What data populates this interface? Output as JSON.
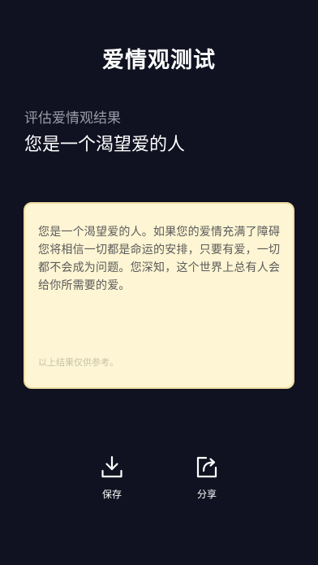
{
  "header": {
    "title": "爱情观测试"
  },
  "result": {
    "subtitle": "评估爱情观结果",
    "headline": "您是一个渴望爱的人"
  },
  "card": {
    "body": "您是一个渴望爱的人。如果您的爱情充满了障碍您将相信一切都是命运的安排，只要有爱，一切都不会成为问题。您深知，这个世界上总有人会给你所需要的爱。",
    "note": "以上结果仅供参考。",
    "background_color": "#fdf5d3",
    "border_color": "#efdea0"
  },
  "actions": {
    "save": {
      "label": "保存",
      "icon": "download-icon"
    },
    "share": {
      "label": "分享",
      "icon": "share-icon"
    }
  },
  "colors": {
    "background": "#101221",
    "title": "#ffffff",
    "subtitle": "#9a9ba8"
  }
}
